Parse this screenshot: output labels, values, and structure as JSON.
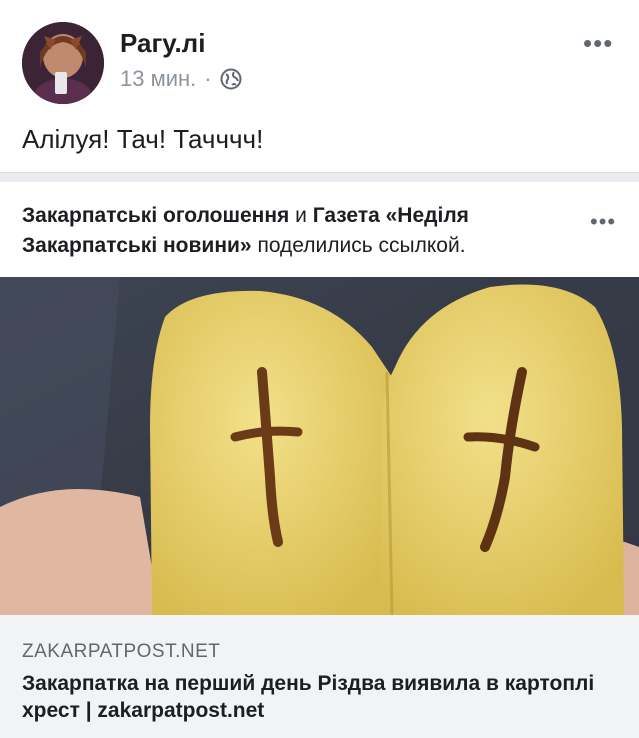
{
  "post": {
    "author": "Рагу.лі",
    "time": "13 мин.",
    "dot": "·",
    "privacy_icon": "globe-icon",
    "more_icon": "more-dots-icon",
    "text": "Алілуя! Тач! Тачччч!"
  },
  "share": {
    "page1": "Закарпатські оголошення",
    "conj": " и ",
    "page2": "Газета «Неділя Закарпатські новини»",
    "action": " поделились ссылкой.",
    "more_icon": "more-dots-icon"
  },
  "link": {
    "domain": "ZAKARPATPOST.NET",
    "title": "Закарпатка на перший день Різдва виявила в картоплі хрест | zakarpatpost.net"
  },
  "colors": {
    "separator": "#e9ebee",
    "link_card": "#f2f3f5",
    "meta_text": "#8d949e",
    "potato": "#e9d36a"
  }
}
